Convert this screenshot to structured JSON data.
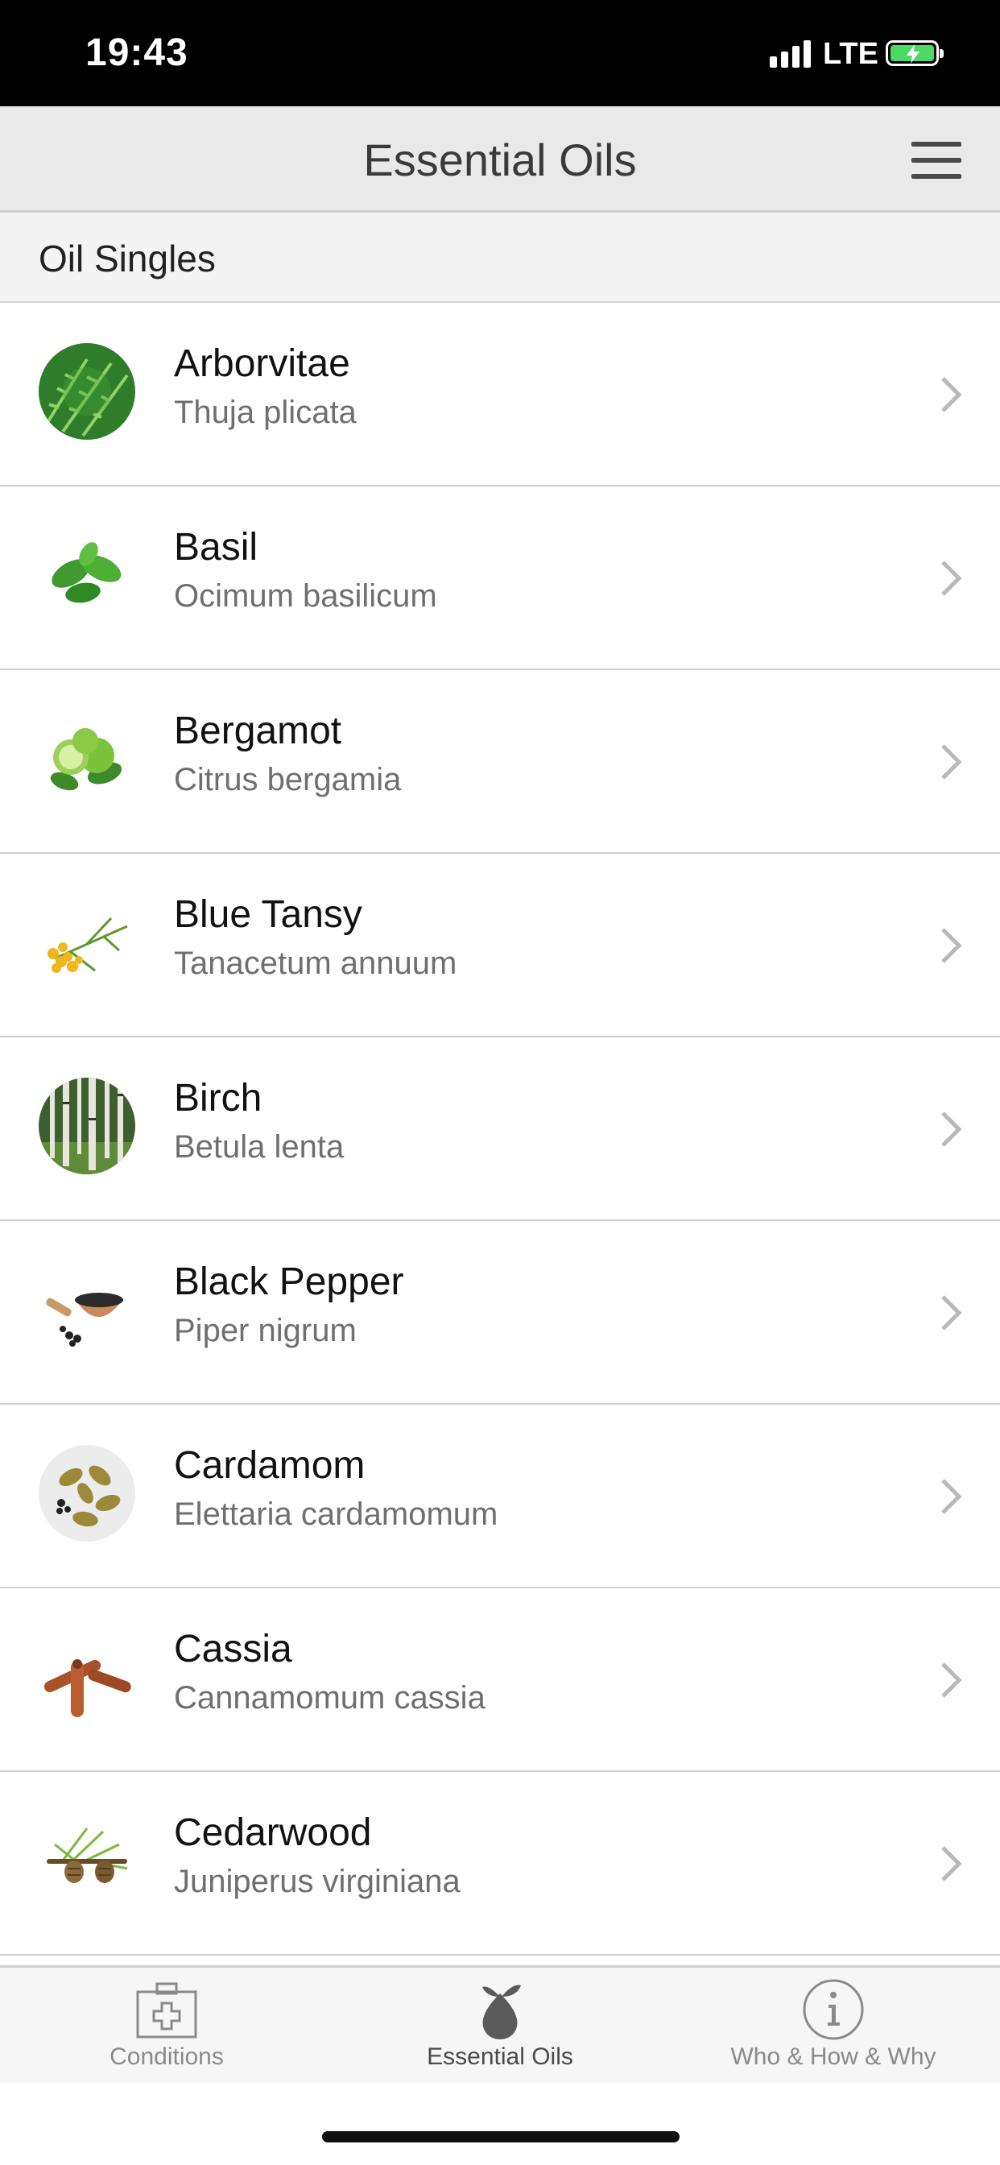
{
  "status_bar": {
    "time": "19:43",
    "network": "LTE",
    "signal_icon": "signal-bars-icon",
    "battery_icon": "battery-charging-icon",
    "battery_color": "#4cd964"
  },
  "nav": {
    "title": "Essential Oils",
    "menu_icon": "hamburger-menu-icon"
  },
  "section": {
    "title": "Oil Singles"
  },
  "oils": [
    {
      "name": "Arborvitae",
      "latin": "Thuja plicata",
      "thumb_icon": "arborvitae-leaf-thumbnail"
    },
    {
      "name": "Basil",
      "latin": "Ocimum basilicum",
      "thumb_icon": "basil-leaves-thumbnail"
    },
    {
      "name": "Bergamot",
      "latin": "Citrus bergamia",
      "thumb_icon": "bergamot-citrus-thumbnail"
    },
    {
      "name": "Blue Tansy",
      "latin": "Tanacetum annuum",
      "thumb_icon": "tansy-flower-thumbnail"
    },
    {
      "name": "Birch",
      "latin": "Betula lenta",
      "thumb_icon": "birch-forest-thumbnail"
    },
    {
      "name": "Black Pepper",
      "latin": "Piper nigrum",
      "thumb_icon": "peppercorn-bowl-thumbnail"
    },
    {
      "name": "Cardamom",
      "latin": "Elettaria cardamomum",
      "thumb_icon": "cardamom-pods-thumbnail"
    },
    {
      "name": "Cassia",
      "latin": "Cannamomum cassia",
      "thumb_icon": "cinnamon-sticks-thumbnail"
    },
    {
      "name": "Cedarwood",
      "latin": "Juniperus virginiana",
      "thumb_icon": "cedar-cones-thumbnail"
    }
  ],
  "tabs": [
    {
      "label": "Conditions",
      "icon": "first-aid-kit-icon",
      "active": false
    },
    {
      "label": "Essential Oils",
      "icon": "oil-drop-leaf-icon",
      "active": true
    },
    {
      "label": "Who & How & Why",
      "icon": "info-circle-icon",
      "active": false
    }
  ]
}
